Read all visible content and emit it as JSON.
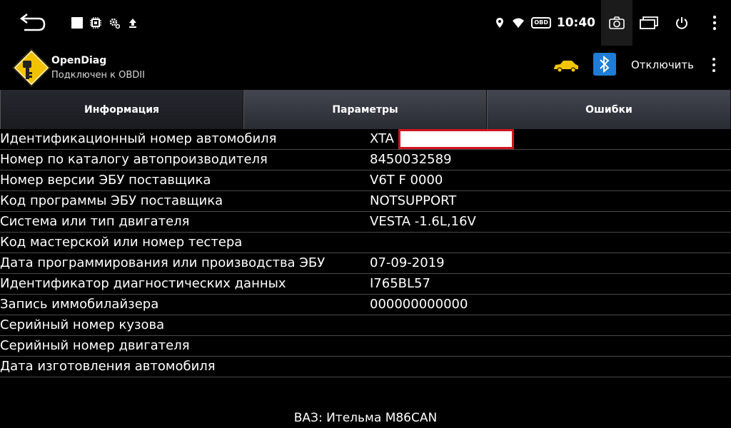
{
  "status_bar": {
    "time": "10:40",
    "obd_badge": "OBD"
  },
  "app": {
    "title": "OpenDiag",
    "subtitle": "Подключен к OBDII",
    "disconnect_label": "Отключить"
  },
  "tabs": [
    {
      "label": "Информация",
      "active": true
    },
    {
      "label": "Параметры",
      "active": false
    },
    {
      "label": "Ошибки",
      "active": false
    }
  ],
  "rows": [
    {
      "label": "Идентификационный номер автомобиля",
      "value": "XTA"
    },
    {
      "label": "Номер по каталогу автопроизводителя",
      "value": "8450032589"
    },
    {
      "label": "Номер версии ЭБУ поставщика",
      "value": "V6T F 0000"
    },
    {
      "label": "Код программы ЭБУ поставщика",
      "value": "NOTSUPPORT"
    },
    {
      "label": "Система или тип двигателя",
      "value": "VESTA -1.6L,16V"
    },
    {
      "label": "Код мастерской или номер тестера",
      "value": ""
    },
    {
      "label": "Дата программирования или производства ЭБУ",
      "value": "07-09-2019"
    },
    {
      "label": "Идентификатор диагностических данных",
      "value": "I765BL57"
    },
    {
      "label": "Запись иммобилайзера",
      "value": "000000000000"
    },
    {
      "label": "Серийный номер кузова",
      "value": ""
    },
    {
      "label": "Серийный номер двигателя",
      "value": ""
    },
    {
      "label": "Дата изготовления автомобиля",
      "value": ""
    }
  ],
  "footer": "ВАЗ: Ительма M86CAN",
  "colors": {
    "background": "#000000",
    "tab_bg": "#3a3d45",
    "car_icon": "#f2c500",
    "bluetooth": "#1e7dd7",
    "redaction_border": "#d2141c"
  }
}
